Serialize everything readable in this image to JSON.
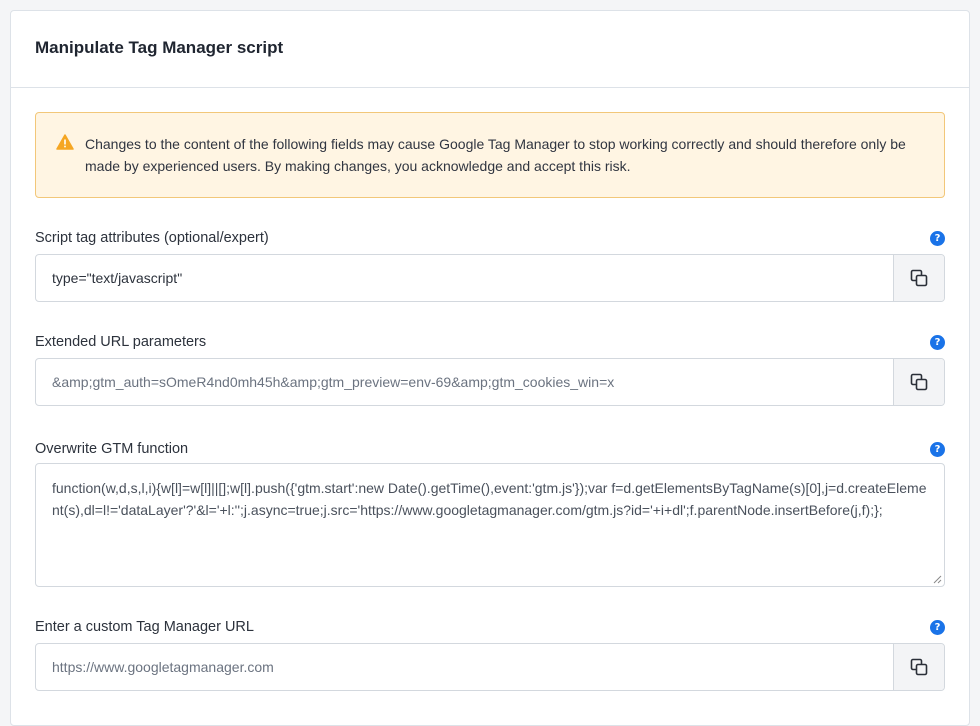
{
  "panel": {
    "title": "Manipulate Tag Manager script"
  },
  "alert": {
    "icon": "warning-icon",
    "color": "#f5a623",
    "text": "Changes to the content of the following fields may cause Google Tag Manager to stop working correctly and should therefore only be made by experienced users. By making changes, you acknowledge and accept this risk."
  },
  "fields": {
    "script_attributes": {
      "label": "Script tag attributes (optional/expert)",
      "value": "type=\"text/javascript\"",
      "help_icon": "?"
    },
    "url_params": {
      "label": "Extended URL parameters",
      "placeholder": "&amp;gtm_auth=sOmeR4nd0mh45h&amp;gtm_preview=env-69&amp;gtm_cookies_win=x",
      "help_icon": "?"
    },
    "gtm_function": {
      "label": "Overwrite GTM function",
      "placeholder": "function(w,d,s,l,i){w[l]=w[l]||[];w[l].push({'gtm.start':new Date().getTime(),event:'gtm.js'});var f=d.getElementsByTagName(s)[0],j=d.createElement(s),dl=l!='dataLayer'?'&l='+l:'';j.async=true;j.src='https://www.googletagmanager.com/gtm.js?id='+i+dl';f.parentNode.insertBefore(j,f);};",
      "help_icon": "?"
    },
    "custom_url": {
      "label": "Enter a custom Tag Manager URL",
      "placeholder": "https://www.googletagmanager.com",
      "help_icon": "?"
    }
  },
  "colors": {
    "help": "#1a73e8",
    "alert_bg": "#fff5e3",
    "alert_border": "#f2c779"
  }
}
